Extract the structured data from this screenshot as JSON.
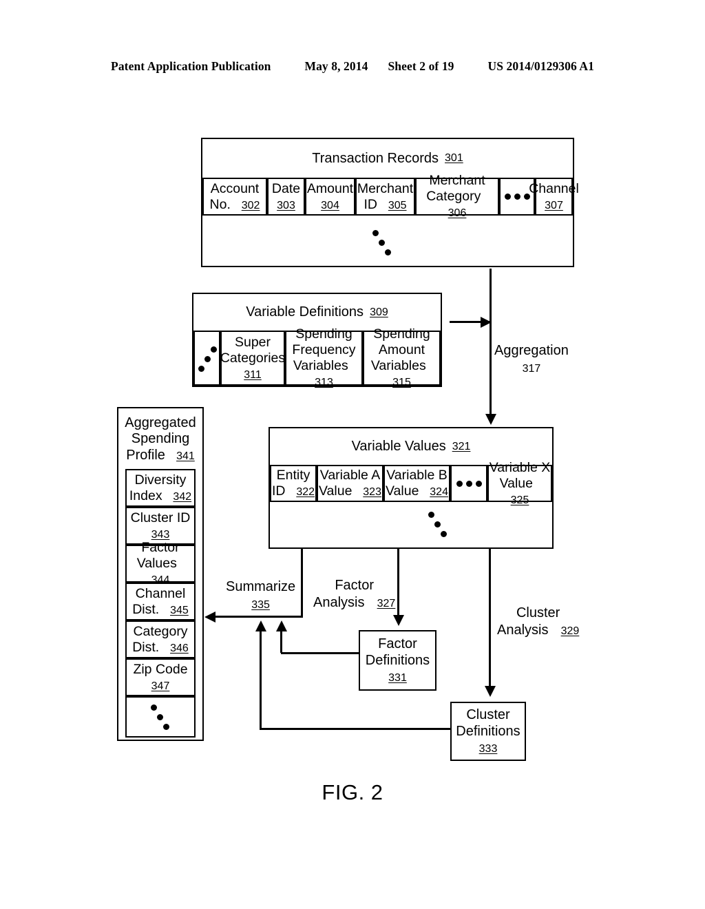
{
  "header": {
    "publication": "Patent Application Publication",
    "date": "May 8, 2014",
    "sheet": "Sheet 2 of 19",
    "patent_number": "US 2014/0129306 A1"
  },
  "figure": {
    "caption": "FIG. 2"
  },
  "transaction_records": {
    "title": "Transaction Records",
    "title_ref": "301",
    "columns": [
      {
        "line1": "Account",
        "line2": "No.",
        "ref": "302"
      },
      {
        "line1": "Date",
        "line2": "",
        "ref": "303"
      },
      {
        "line1": "Amount",
        "line2": "",
        "ref": "304"
      },
      {
        "line1": "Merchant",
        "line2": "ID",
        "ref": "305"
      },
      {
        "line1": "Merchant",
        "line2": "Category",
        "ref": "306"
      },
      {
        "line1": "",
        "line2": "",
        "ref": "",
        "icon": "horizontal-ellipsis"
      },
      {
        "line1": "Channel",
        "line2": "",
        "ref": "307"
      }
    ],
    "body_icon": "diagonal-ellipsis"
  },
  "variable_definitions": {
    "title": "Variable Definitions",
    "title_ref": "309",
    "columns": [
      {
        "line1": "",
        "line2": "",
        "line3": "",
        "ref": "",
        "icon": "diagonal-ellipsis"
      },
      {
        "line1": "Super",
        "line2": "Categories",
        "line3": "",
        "ref": "311"
      },
      {
        "line1": "Spending",
        "line2": "Frequency",
        "line3": "Variables",
        "ref": "313"
      },
      {
        "line1": "Spending",
        "line2": "Amount",
        "line3": "Variables",
        "ref": "315"
      }
    ]
  },
  "variable_values": {
    "title": "Variable Values",
    "title_ref": "321",
    "columns": [
      {
        "line1": "Entity",
        "line2": "ID",
        "ref": "322"
      },
      {
        "line1": "Variable A",
        "line2": "Value",
        "ref": "323"
      },
      {
        "line1": "Variable B",
        "line2": "Value",
        "ref": "324"
      },
      {
        "line1": "",
        "line2": "",
        "ref": "",
        "icon": "horizontal-ellipsis"
      },
      {
        "line1": "Variable X",
        "line2": "Value",
        "ref": "325"
      }
    ],
    "body_icon": "diagonal-ellipsis"
  },
  "aggregated_spending_profile": {
    "title_line1": "Aggregated",
    "title_line2": "Spending",
    "title_line3": "Profile",
    "title_ref": "341",
    "fields": [
      {
        "line1": "Diversity",
        "line2": "Index",
        "ref": "342",
        "ref_inline": true
      },
      {
        "line1": "Cluster ID",
        "line2": "",
        "ref": "343",
        "ref_inline": false
      },
      {
        "line1": "Factor",
        "line2": "Values",
        "ref": "344",
        "ref_inline": true
      },
      {
        "line1": "Channel",
        "line2": "Dist.",
        "ref": "345",
        "ref_inline": true
      },
      {
        "line1": "Category",
        "line2": "Dist.",
        "ref": "346",
        "ref_inline": true
      },
      {
        "line1": "Zip Code",
        "line2": "",
        "ref": "347",
        "ref_inline": false
      },
      {
        "line1": "",
        "line2": "",
        "ref": "",
        "icon": "diagonal-ellipsis"
      }
    ]
  },
  "factor_definitions": {
    "line1": "Factor",
    "line2": "Definitions",
    "ref": "331"
  },
  "cluster_definitions": {
    "line1": "Cluster",
    "line2": "Definitions",
    "ref": "333"
  },
  "process_labels": {
    "aggregation": {
      "line1": "Aggregation",
      "ref": "317",
      "underlined": false
    },
    "summarize": {
      "line1": "Summarize",
      "ref": "335",
      "underlined": true
    },
    "factor_analysis": {
      "line1": "Factor",
      "line2": "Analysis",
      "ref": "327",
      "underlined": true
    },
    "cluster_analysis": {
      "line1": "Cluster",
      "line2": "Analysis",
      "ref": "329",
      "underlined": true
    }
  },
  "colors": {
    "ink": "#000000",
    "paper": "#ffffff"
  }
}
